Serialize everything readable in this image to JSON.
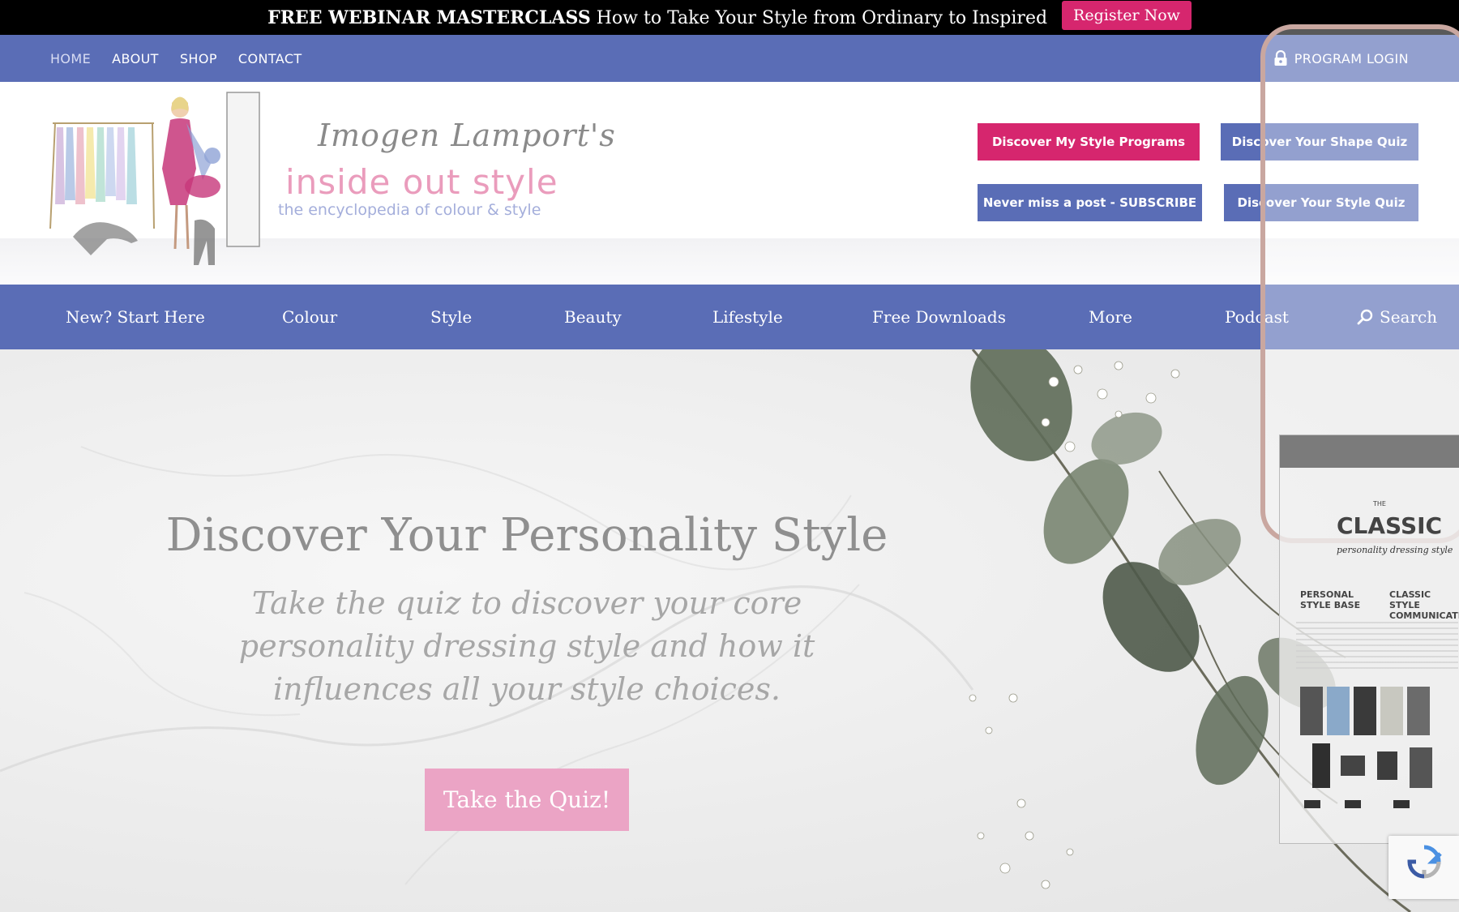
{
  "promo": {
    "bold_text": "FREE WEBINAR MASTERCLASS",
    "text": "How to Take Your Style from Ordinary to Inspired",
    "button_label": "Register Now"
  },
  "topnav": {
    "links": [
      "HOME",
      "ABOUT",
      "SHOP",
      "CONTACT"
    ],
    "active": "HOME",
    "login_label": "PROGRAM LOGIN",
    "login_icon": "lock-icon"
  },
  "header": {
    "logo_script": "Imogen Lamport's",
    "logo_main": "inside out style",
    "logo_tagline": "the encyclopedia of colour & style",
    "buttons": [
      {
        "label": "Discover My Style Programs",
        "color": "#d6266e"
      },
      {
        "label": "Discover Your Shape Quiz",
        "color": "#5a6db6"
      },
      {
        "label": "Never miss a post - SUBSCRIBE",
        "color": "#5a6db6"
      },
      {
        "label": "Discover Your Style Quiz",
        "color": "#5a6db6"
      }
    ]
  },
  "mainnav": {
    "items": [
      "New? Start Here",
      "Colour",
      "Style",
      "Beauty",
      "Lifestyle",
      "Free Downloads",
      "More",
      "Podcast"
    ],
    "search_label": "Search",
    "search_icon": "search-icon"
  },
  "hero": {
    "title": "Discover Your Personality Style",
    "subtitle": "Take the quiz to discover your core personality dressing style and how it influences all your style choices.",
    "button_label": "Take the Quiz!",
    "phone": {
      "title_small": "THE",
      "title": "CLASSIC",
      "subtitle": "personality dressing style",
      "col1": "PERSONAL STYLE BASE",
      "col2": "CLASSIC STYLE COMMUNICATES"
    }
  },
  "colors": {
    "brand_blue": "#5a6db6",
    "brand_pink": "#d6266e",
    "hero_button": "#eba4c5",
    "logo_pink": "#ea9cbc"
  }
}
